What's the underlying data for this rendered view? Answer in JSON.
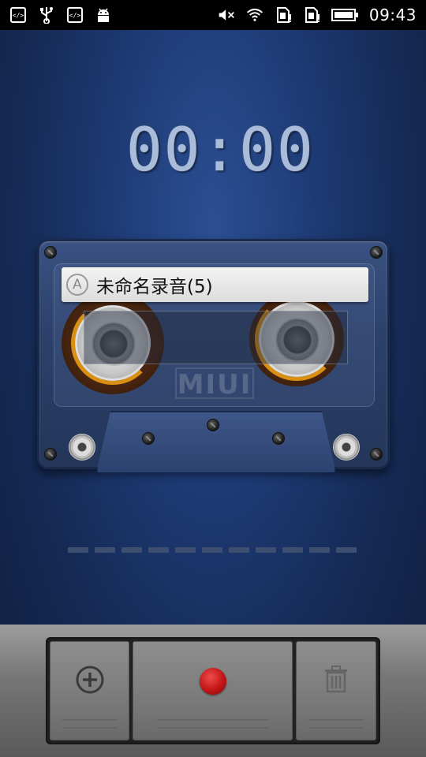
{
  "status_bar": {
    "left_icons": [
      "code-icon",
      "usb-icon",
      "code-icon",
      "android-icon"
    ],
    "right_icons": [
      "mute-icon",
      "wifi-icon",
      "sim1-icon",
      "sim2-icon",
      "battery-icon"
    ],
    "time": "09:43"
  },
  "timer": {
    "display": "00:00"
  },
  "cassette": {
    "label_badge": "A",
    "label_text": "未命名录音(5)",
    "brand": "MIUI"
  },
  "meter": {
    "segments": 11,
    "level": 0
  },
  "controls": {
    "add_icon": "add-icon",
    "record_icon": "record-icon",
    "delete_icon": "trash-icon",
    "record_color": "#cc1a1a"
  },
  "colors": {
    "accent": "#d99012",
    "background": "#1e3a74"
  }
}
